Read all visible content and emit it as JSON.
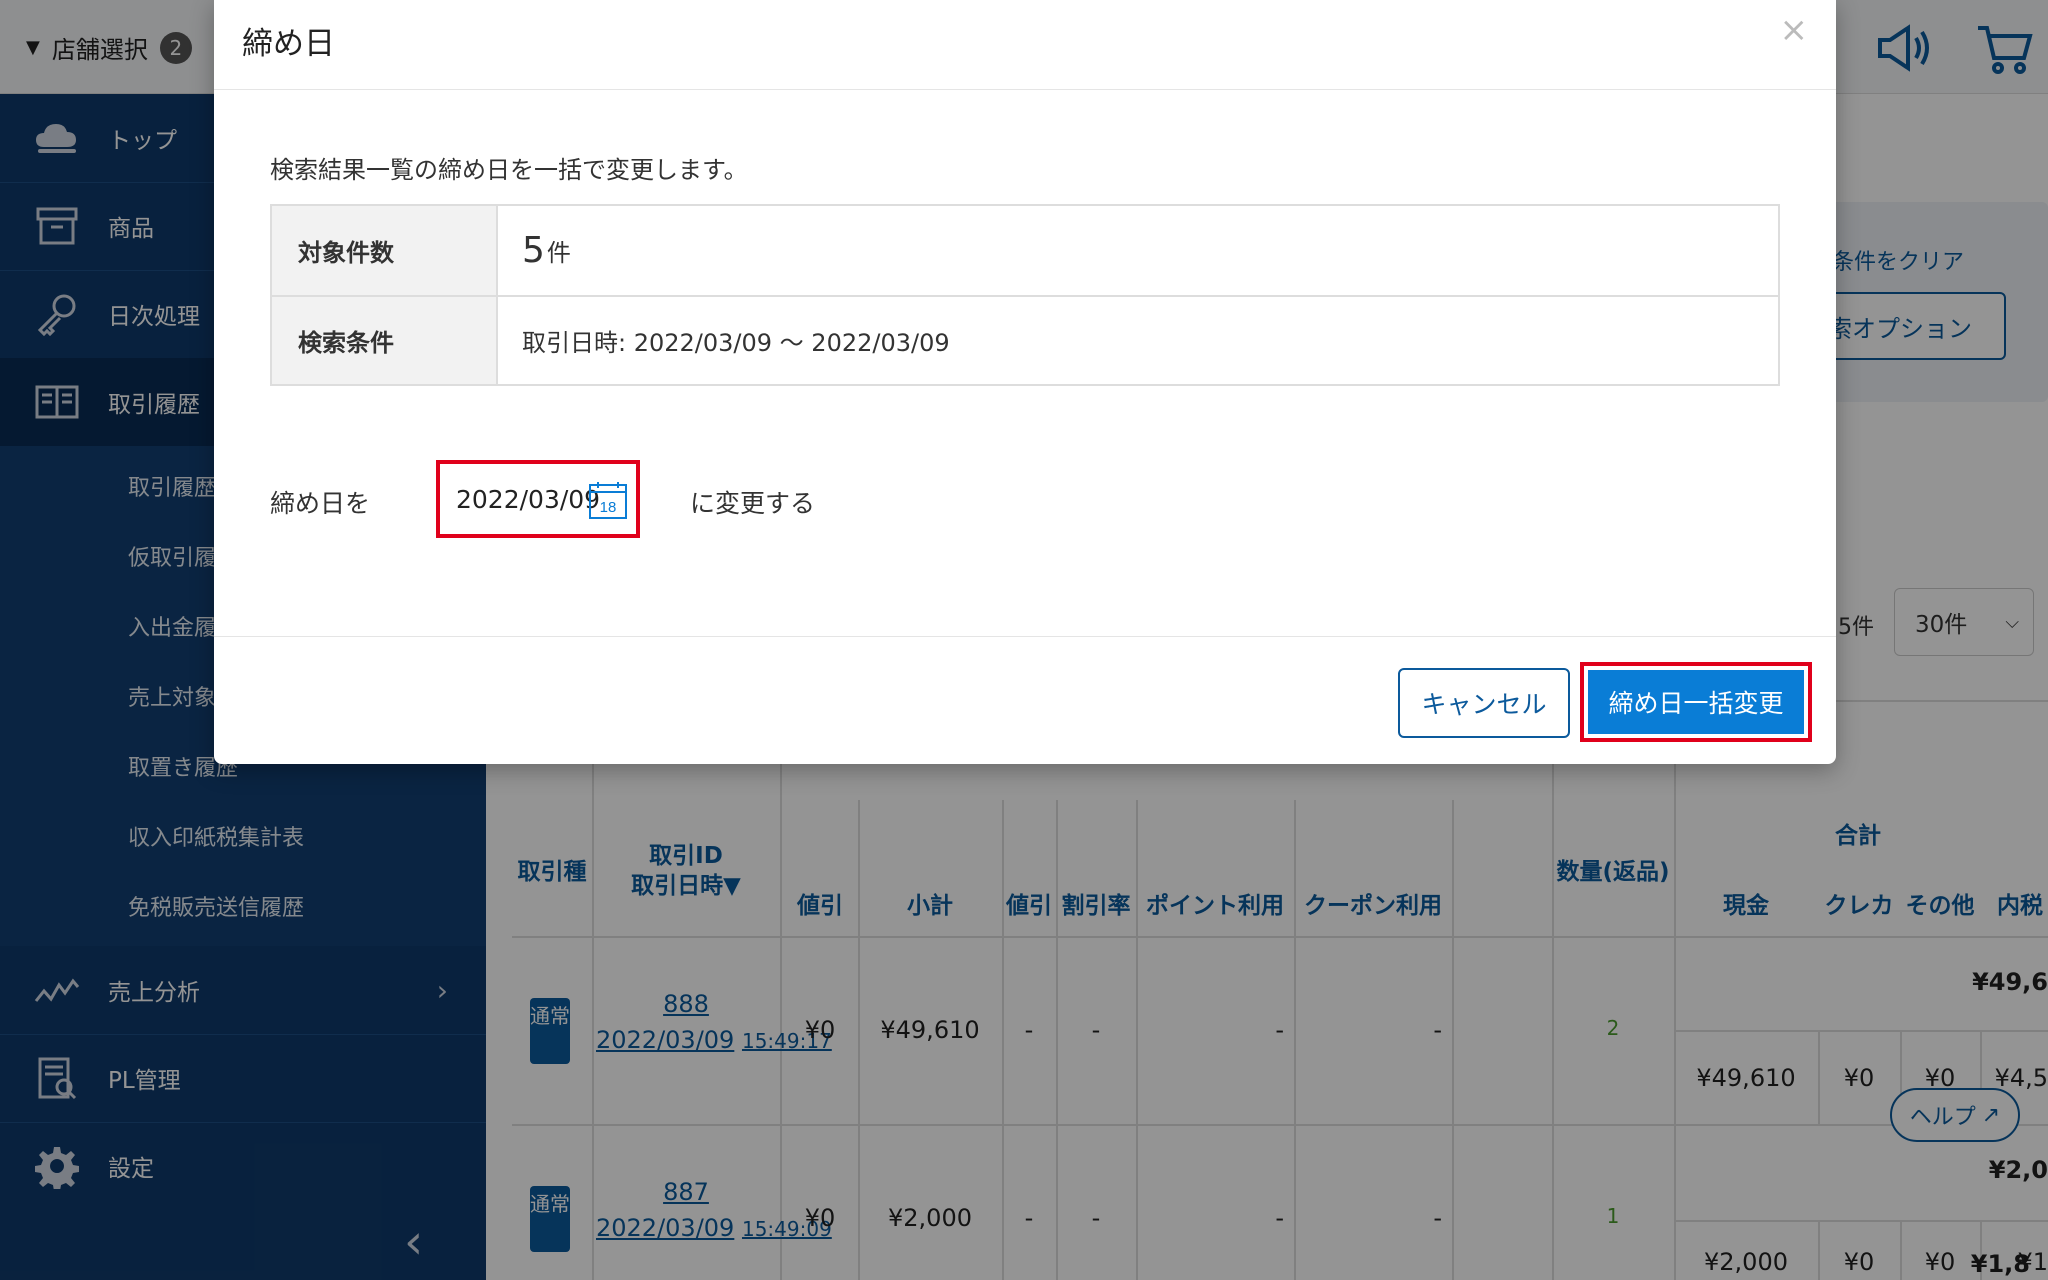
{
  "header": {
    "store_select_label": "店舗選択",
    "store_count": "2",
    "icons": [
      "megaphone-icon",
      "cart-icon"
    ]
  },
  "sidebar": {
    "items": [
      {
        "label": "トップ",
        "icon": "cloud-icon"
      },
      {
        "label": "商品",
        "icon": "box-icon"
      },
      {
        "label": "日次処理",
        "icon": "key-icon"
      },
      {
        "label": "取引履歴",
        "icon": "book-icon"
      },
      {
        "label": "売上分析",
        "icon": "chart-line-icon"
      },
      {
        "label": "PL管理",
        "icon": "report-icon"
      },
      {
        "label": "設定",
        "icon": "gear-icon"
      }
    ],
    "sub_items": [
      "取引履歴",
      "仮取引履歴",
      "入出金履歴",
      "売上対象",
      "取置き履歴",
      "収入印紙税集計表",
      "免税販売送信履歴"
    ]
  },
  "main": {
    "clear_link": "検索条件をクリア",
    "option_button": "検索オプション",
    "result_count": "5件",
    "per_page": "30件",
    "table": {
      "headers": {
        "type": "取引種",
        "id_date_top": "取引ID",
        "id_date": "取引日時▼",
        "discount": "値引",
        "subtotal": "小計",
        "discount2": "値引",
        "discount_rate": "割引率",
        "point": "ポイント利用",
        "coupon": "クーポン利用",
        "qty": "数量(返品)",
        "total": "合計",
        "cash": "現金",
        "credit": "クレカ",
        "other": "その他",
        "tax": "内税"
      },
      "rows": [
        {
          "tag": "通常",
          "id": "888",
          "date": "2022/03/09",
          "time": "15:49:17",
          "discount": "¥0",
          "subtotal": "¥49,610",
          "discount2": "-",
          "discount_rate": "-",
          "point": "-",
          "coupon": "-",
          "qty": "2",
          "total": "¥49,6",
          "cash": "¥49,610",
          "credit": "¥0",
          "other": "¥0",
          "tax": "¥4,5"
        },
        {
          "tag": "通常",
          "id": "887",
          "date": "2022/03/09",
          "time": "15:49:09",
          "discount": "¥0",
          "subtotal": "¥2,000",
          "discount2": "-",
          "discount_rate": "-",
          "point": "-",
          "coupon": "-",
          "qty": "1",
          "total": "¥2,0",
          "cash": "¥2,000",
          "credit": "¥0",
          "other": "¥0",
          "tax": "¥1"
        }
      ],
      "row3_total": "¥1,8"
    },
    "help_button": "ヘルプ"
  },
  "modal": {
    "title": "締め日",
    "close": "×",
    "description": "検索結果一覧の締め日を一括で変更します。",
    "target_count_label": "対象件数",
    "target_count_value": "5",
    "target_count_unit": "件",
    "conditions_label": "検索条件",
    "conditions_value": "取引日時: 2022/03/09 〜 2022/03/09",
    "date_prefix": "締め日を",
    "date_value": "2022/03/09",
    "calendar_day": "18",
    "date_suffix": "に変更する",
    "cancel_button": "キャンセル",
    "submit_button": "締め日一括変更"
  }
}
